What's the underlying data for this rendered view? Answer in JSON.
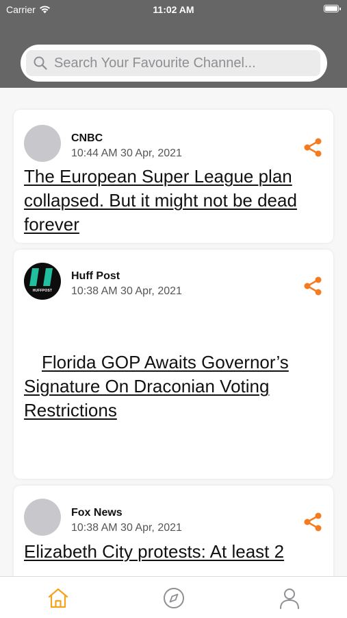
{
  "status": {
    "carrier": "Carrier",
    "time": "11:02 AM"
  },
  "search": {
    "placeholder": "Search Your Favourite Channel..."
  },
  "accent_color": "#f47b20",
  "articles": [
    {
      "source": "CNBC",
      "date": "10:44 AM 30 Apr, 2021",
      "headline": "The European Super League plan collapsed. But it might not be dead forever",
      "avatar_icon": "placeholder-avatar"
    },
    {
      "source": "Huff Post",
      "date": "10:38 AM 30 Apr, 2021",
      "headline": "Florida GOP Awaits Governor’s Signature On Draconian Voting Restrictions",
      "avatar_icon": "huffpost-logo",
      "logo_text": "HUFFPOST"
    },
    {
      "source": "Fox News",
      "date": "10:38 AM 30 Apr, 2021",
      "headline": "Elizabeth City protests: At least 2",
      "avatar_icon": "placeholder-avatar"
    }
  ],
  "tabs": [
    {
      "name": "home",
      "icon": "home-icon",
      "active": true
    },
    {
      "name": "explore",
      "icon": "compass-icon",
      "active": false
    },
    {
      "name": "profile",
      "icon": "user-icon",
      "active": false
    }
  ]
}
